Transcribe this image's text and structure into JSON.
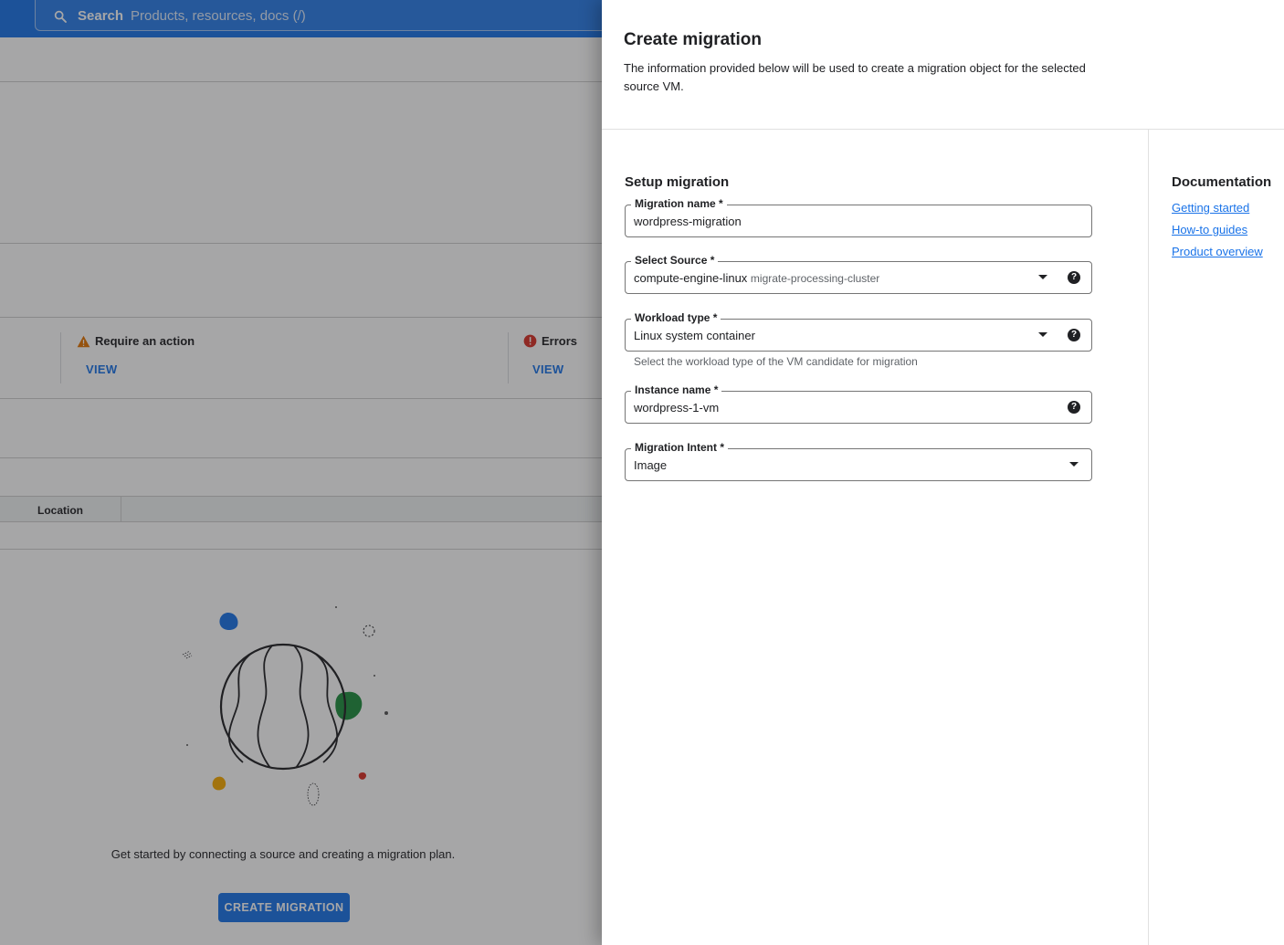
{
  "search": {
    "label": "Search",
    "placeholder": "Products, resources, docs (/)"
  },
  "background": {
    "status": [
      {
        "title": "Require an action",
        "link": "VIEW",
        "icon": "warning-icon"
      },
      {
        "title": "Errors",
        "link": "VIEW",
        "icon": "error-icon"
      }
    ],
    "table": {
      "columns": [
        "Location"
      ]
    },
    "empty_state": {
      "text": "Get started by connecting a source and creating a migration plan.",
      "button": "CREATE MIGRATION"
    }
  },
  "panel": {
    "title": "Create migration",
    "description": "The information provided below will be used to create a migration object for the selected source VM.",
    "section_title": "Setup migration",
    "fields": {
      "migration_name": {
        "label": "Migration name *",
        "value": "wordpress-migration"
      },
      "select_source": {
        "label": "Select Source *",
        "value": "compute-engine-linux",
        "sub": "migrate-processing-cluster"
      },
      "workload_type": {
        "label": "Workload type *",
        "value": "Linux system container",
        "hint": "Select the workload type of the VM candidate for migration"
      },
      "instance_name": {
        "label": "Instance name *",
        "value": "wordpress-1-vm"
      },
      "migration_intent": {
        "label": "Migration Intent *",
        "value": "Image"
      }
    },
    "documentation": {
      "title": "Documentation",
      "links": [
        "Getting started",
        "How-to guides",
        "Product overview"
      ]
    }
  },
  "colors": {
    "brand_blue": "#1a73e8",
    "warning": "#e37400",
    "error": "#d93025"
  }
}
